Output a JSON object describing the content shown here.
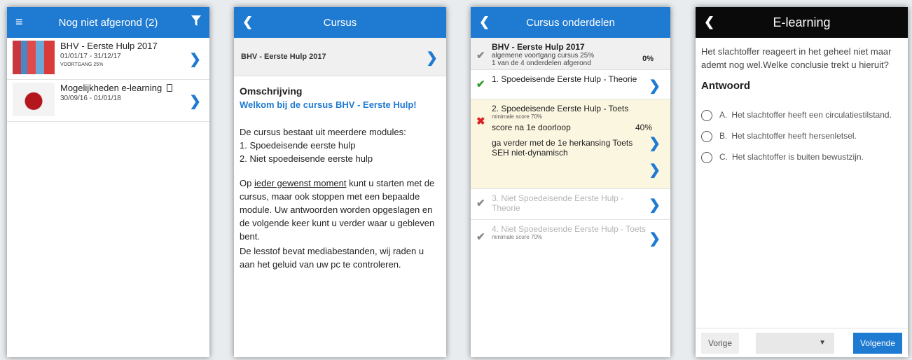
{
  "screen1": {
    "title": "Nog niet afgerond (2)",
    "menu_icon": "hamburger-icon",
    "filter_icon": "filter-icon",
    "courses": [
      {
        "title": "BHV - Eerste Hulp 2017",
        "dates": "01/01/17 - 31/12/17",
        "progress": "VOORTGANG 25%"
      },
      {
        "title": "Mogelijkheden e-learning",
        "title_icon": "mobile-icon",
        "dates": "30/09/16 - 01/01/18"
      }
    ]
  },
  "screen2": {
    "title": "Cursus",
    "course_title": "BHV - Eerste Hulp 2017",
    "heading": "Omschrijving",
    "welcome": "Welkom bij de cursus BHV - Eerste Hulp!",
    "intro": "De cursus bestaat uit meerdere modules:",
    "module1": "1. Spoedeisende eerste hulp",
    "module2": "2. Niet spoedeisende eerste hulp",
    "para_start": "Op ",
    "para_link": "ieder gewenst moment",
    "para_rest": " kunt u starten met de cursus, maar ook stoppen met een bepaalde module. Uw antwoorden worden opgeslagen en de volgende keer kunt u verder waar u gebleven bent.",
    "media_note": "De lesstof bevat mediabestanden, wij raden u aan het geluid van uw pc te controleren."
  },
  "screen3": {
    "title": "Cursus onderdelen",
    "course_title": "BHV - Eerste Hulp 2017",
    "overall_progress": "algemene voortgang cursus 25%",
    "completed": "1 van de 4 onderdelen afgerond",
    "percent": "0%",
    "modules": [
      {
        "label": "1. Spoedeisende Eerste Hulp - Theorie",
        "status": "passed"
      },
      {
        "label": "2. Spoedeisende Eerste Hulp - Toets",
        "min_score": "minimale score 70%",
        "score_label": "score na 1e doorloop",
        "score_value": "40%",
        "next_step": "ga verder met de 1e herkansing Toets SEH niet-dynamisch",
        "status": "failed"
      },
      {
        "label": "3. Niet Spoedeisende Eerste Hulp - Theorie",
        "status": "locked"
      },
      {
        "label": "4. Niet Spoedeisende Eerste Hulp - Toets",
        "min_score": "minimale score 70%",
        "status": "locked"
      }
    ],
    "colors": {
      "pass": "#2e9a2e",
      "fail": "#e02020",
      "locked": "#888888"
    }
  },
  "screen4": {
    "title": "E-learning",
    "question": "Het slachtoffer reageert in het geheel niet maar ademt nog wel.Welke conclusie trekt u hieruit?",
    "answer_heading": "Antwoord",
    "options": [
      {
        "letter": "A.",
        "text": "Het slachtoffer heeft een circulatiestilstand."
      },
      {
        "letter": "B.",
        "text": "Het slachtoffer heeft hersenletsel."
      },
      {
        "letter": "C.",
        "text": "Het slachtoffer is buiten bewustzijn."
      }
    ],
    "prev_label": "Vorige",
    "next_label": "Volgende",
    "select_value": ""
  },
  "colors": {
    "accent": "#1f7ad1",
    "dark_header": "#0a0a0a"
  }
}
